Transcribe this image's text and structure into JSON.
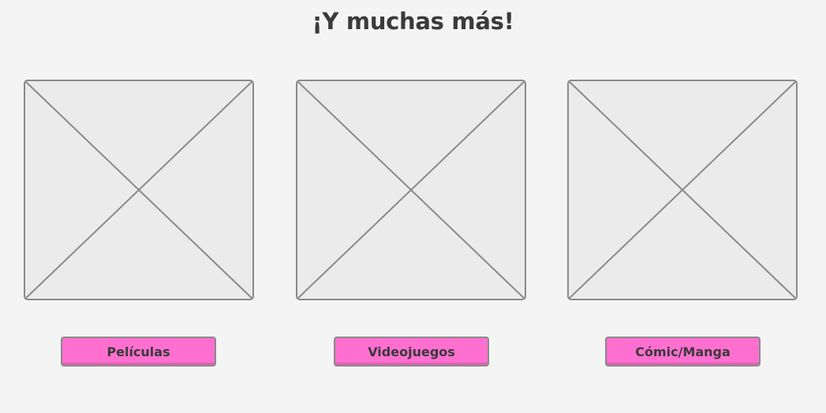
{
  "header": {
    "title": "¡Y muchas más!"
  },
  "cards": [
    {
      "image_icon": "image-placeholder-icon",
      "button_label": "Películas"
    },
    {
      "image_icon": "image-placeholder-icon",
      "button_label": "Videojuegos"
    },
    {
      "image_icon": "image-placeholder-icon",
      "button_label": "Cómic/Manga"
    }
  ],
  "colors": {
    "background": "#f4f4f4",
    "placeholder_fill": "#ebebeb",
    "placeholder_stroke": "#8a8a8a",
    "button_fill": "#ff6fd0",
    "text": "#3a3a3a"
  }
}
